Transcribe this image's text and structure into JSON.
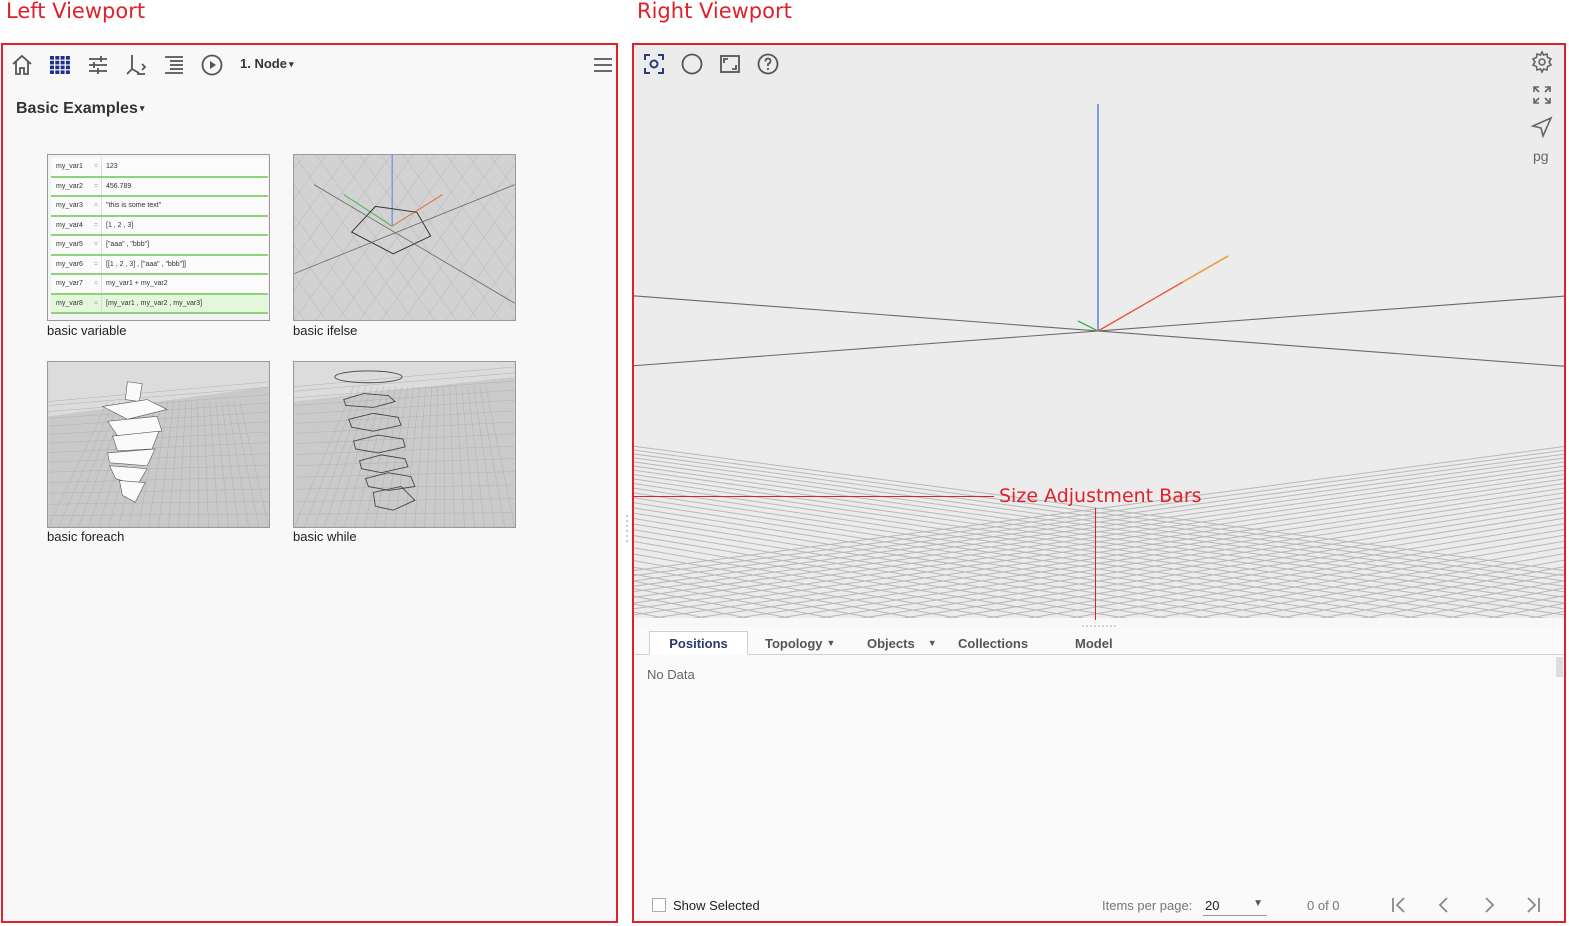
{
  "annotations": {
    "left_viewport_label": "Left Viewport",
    "right_viewport_label": "Right Viewport",
    "size_adjustment_label": "Size Adjustment Bars",
    "color": "#e0202a"
  },
  "left": {
    "toolbar": {
      "icons": [
        "home-icon",
        "gallery-grid-icon",
        "sliders-icon",
        "flowchart-icon",
        "list-icon",
        "play-circle-icon",
        "menu-icon"
      ],
      "node_dropdown": "1. Node"
    },
    "section_title": "Basic Examples",
    "examples": [
      {
        "caption": "basic variable"
      },
      {
        "caption": "basic ifelse"
      },
      {
        "caption": "basic foreach"
      },
      {
        "caption": "basic while"
      }
    ],
    "variable_preview": [
      {
        "name": "my_var1",
        "eq": "=",
        "value": "123"
      },
      {
        "name": "my_var2",
        "eq": "=",
        "value": "456.789"
      },
      {
        "name": "my_var3",
        "eq": "=",
        "value": "\"this is some text\""
      },
      {
        "name": "my_var4",
        "eq": "=",
        "value": "[1 , 2 , 3]"
      },
      {
        "name": "my_var5",
        "eq": "=",
        "value": "[\"aaa\" , \"bbb\"]"
      },
      {
        "name": "my_var6",
        "eq": "=",
        "value": "[[1 , 2 , 3] , [\"aaa\" , \"bbb\"]]"
      },
      {
        "name": "my_var7",
        "eq": "=",
        "value": "my_var1 + my_var2"
      },
      {
        "name": "my_var8",
        "eq": "=",
        "value": "[my_var1 , my_var2 , my_var3]"
      }
    ]
  },
  "right": {
    "toolbar_icons": [
      "zoom-fit-icon",
      "circle-icon",
      "fullscreen-frame-icon",
      "help-icon"
    ],
    "side_icons": [
      "settings-icon",
      "expand-icon",
      "navigate-icon"
    ],
    "pg_label": "pg",
    "tabs": [
      {
        "label": "Positions",
        "active": true,
        "dropdown": false
      },
      {
        "label": "Topology",
        "active": false,
        "dropdown": true
      },
      {
        "label": "Objects",
        "active": false,
        "dropdown": true
      },
      {
        "label": "Collections",
        "active": false,
        "dropdown": false
      },
      {
        "label": "Model",
        "active": false,
        "dropdown": false
      }
    ],
    "no_data": "No Data",
    "footer": {
      "show_selected": "Show Selected",
      "items_per_page_label": "Items per page:",
      "items_per_page_value": "20",
      "range": "0 of 0"
    }
  }
}
